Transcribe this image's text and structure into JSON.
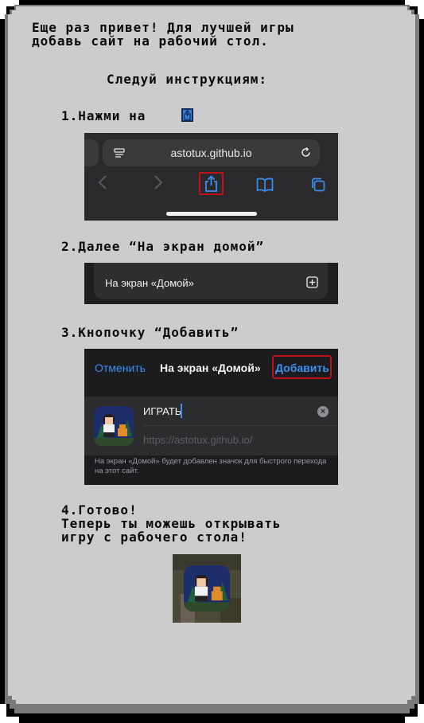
{
  "intro": {
    "line1": "Еще раз привет! Для лучшей игры",
    "line2": "добавь сайт на рабочий стол."
  },
  "instructions_title": "Следуй инструкциям:",
  "steps": {
    "step1": "1.Нажми на",
    "step2": "2.Далее “На экран домой”",
    "step3": "3.Кнопочку “Добавить”",
    "step4_line1": "4.Готово!",
    "step4_line2": "Теперь ты можешь открывать",
    "step4_line3": "игру с рабочего стола!"
  },
  "safari": {
    "url": "astotux.github.io",
    "icons": [
      "reader-icon",
      "reload-icon",
      "back-icon",
      "forward-icon",
      "share-icon",
      "bookmarks-icon",
      "tabs-icon"
    ]
  },
  "share_sheet": {
    "add_to_home_label": "На экран «Домой»",
    "icon": "add-square-icon"
  },
  "add_dialog": {
    "cancel_label": "Отменить",
    "title": "На экран «Домой»",
    "add_label": "Добавить",
    "app_name": "ИГРАТЬ",
    "url": "https://astotux.github.io/",
    "note": "На экран «Домой» будет добавлен значок для быстрого перехода на этот сайт."
  },
  "colors": {
    "panel": "#cccccc",
    "ios_blue": "#3a8ff0",
    "highlight_red": "#c0101a",
    "ios_dark": "#1c1c1e"
  }
}
